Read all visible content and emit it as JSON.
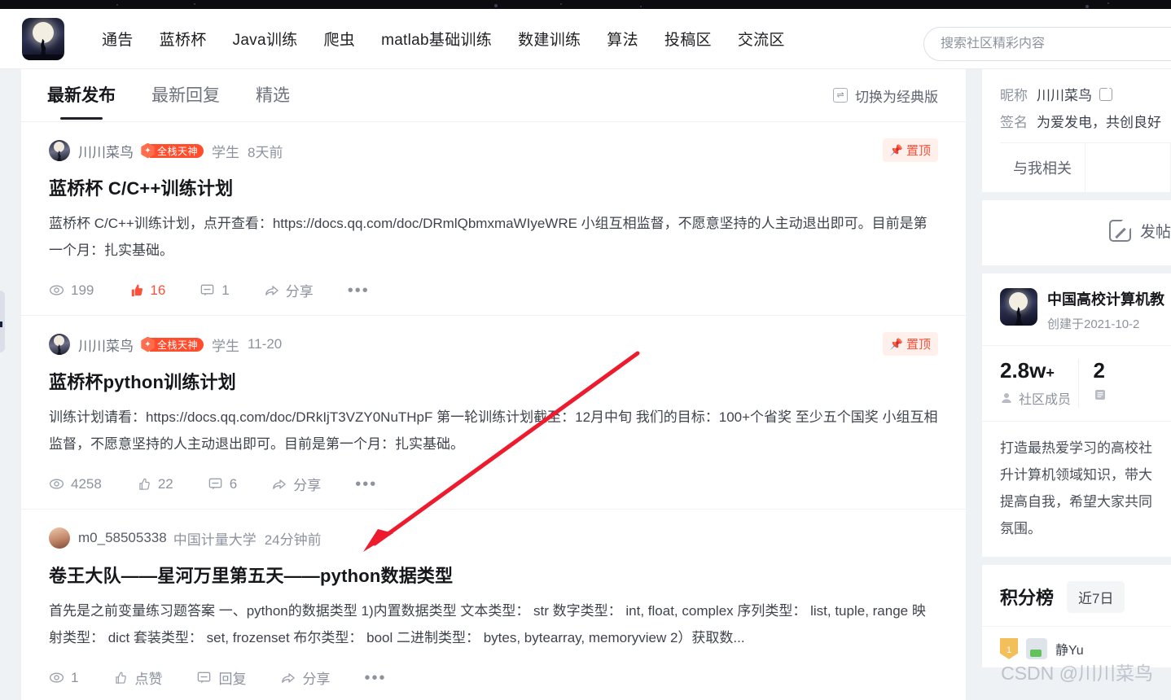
{
  "header": {
    "logo_icon": "community-logo-icon",
    "nav_items": [
      {
        "label": "通告"
      },
      {
        "label": "蓝桥杯"
      },
      {
        "label": "Java训练"
      },
      {
        "label": "爬虫"
      },
      {
        "label": "matlab基础训练"
      },
      {
        "label": "数建训练"
      },
      {
        "label": "算法"
      },
      {
        "label": "投稿区"
      },
      {
        "label": "交流区"
      }
    ],
    "search_placeholder": "搜索社区精彩内容",
    "search_value": ""
  },
  "feed": {
    "tabs": [
      {
        "label": "最新发布",
        "active": true
      },
      {
        "label": "最新回复",
        "active": false
      },
      {
        "label": "精选",
        "active": false
      }
    ],
    "switch_classic_label": "切换为经典版",
    "posts": [
      {
        "author": "川川菜鸟",
        "badge_label": "全栈天神",
        "role": "学生",
        "time": "8天前",
        "pin_label": "置顶",
        "title": "蓝桥杯 C/C++训练计划",
        "body": "蓝桥杯 C/C++训练计划，点开查看：https://docs.qq.com/doc/DRmlQbmxmaWIyeWRE 小组互相监督，不愿意坚持的人主动退出即可。目前是第一个月：扎实基础。",
        "views": "199",
        "likes": "16",
        "comments": "1",
        "share_label": "分享",
        "liked": true
      },
      {
        "author": "川川菜鸟",
        "badge_label": "全栈天神",
        "role": "学生",
        "time": "11-20",
        "pin_label": "置顶",
        "title": "蓝桥杯python训练计划",
        "body": "训练计划请看：https://docs.qq.com/doc/DRkIjT3VZY0NuTHpF 第一轮训练计划截至：12月中旬 我们的目标：100+个省奖 至少五个国奖 小组互相监督，不愿意坚持的人主动退出即可。目前是第一个月：扎实基础。",
        "views": "4258",
        "likes": "22",
        "comments": "6",
        "share_label": "分享",
        "liked": false
      },
      {
        "author": "m0_58505338",
        "badge_label": "",
        "role": "中国计量大学",
        "time": "24分钟前",
        "pin_label": "",
        "title": "卷王大队——星河万里第五天——python数据类型",
        "body": "首先是之前变量练习题答案 一、python的数据类型 1)内置数据类型 文本类型： str 数字类型： int, float, complex 序列类型： list, tuple, range 映射类型： dict 套装类型： set, frozenset 布尔类型： bool 二进制类型： bytes, bytearray, memoryview 2）获取数...",
        "views": "1",
        "likes": "点赞",
        "comments": "回复",
        "share_label": "分享",
        "liked": false
      }
    ]
  },
  "sidebar": {
    "profile": {
      "nickname_label": "昵称",
      "nickname_value": "川川菜鸟",
      "signature_label": "签名",
      "signature_value": "为爱发电，共创良好",
      "edit_icon": "edit-icon",
      "related_tab_label": "与我相关"
    },
    "post_button_label": "发帖",
    "community": {
      "name": "中国高校计算机教",
      "created": "创建于2021-10-2",
      "stats": [
        {
          "value": "2.8w",
          "suffix": "+",
          "label": "社区成员",
          "icon": "user-icon"
        },
        {
          "value": "2",
          "suffix": "",
          "label": "",
          "icon": "doc-icon"
        }
      ],
      "description": "打造最热爱学习的高校社 升计算机领域知识，带大 提高自我，希望大家共同 氛围。"
    },
    "ranking": {
      "title": "积分榜",
      "period_label": "近7日",
      "rows": [
        {
          "rank": "1",
          "name": "静Yu"
        }
      ]
    }
  },
  "watermark": "CSDN @川川菜鸟",
  "colors": {
    "accent_red": "#f1304b",
    "brand_orange": "#fb503b",
    "page_bg": "#eff2f5"
  }
}
